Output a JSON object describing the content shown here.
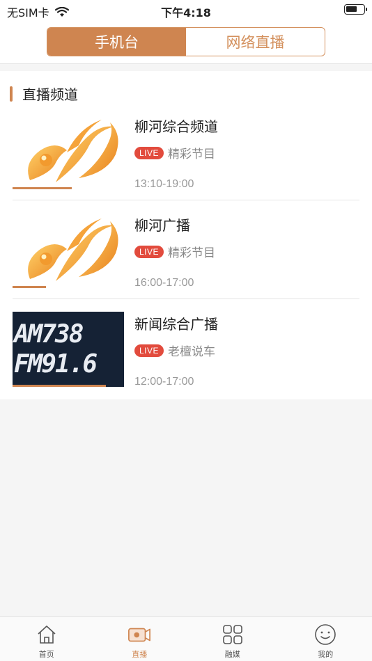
{
  "status_bar": {
    "carrier": "无SIM卡",
    "time": "下午4:18"
  },
  "header": {
    "tabs": [
      {
        "label": "手机台",
        "active": true
      },
      {
        "label": "网络直播",
        "active": false
      }
    ]
  },
  "section": {
    "title": "直播频道"
  },
  "channels": [
    {
      "name": "柳河综合频道",
      "live_label": "LIVE",
      "program": "精彩节目",
      "time": "13:10-19:00",
      "thumb": "swirl-logo",
      "progress": 0.53
    },
    {
      "name": "柳河广播",
      "live_label": "LIVE",
      "program": "精彩节目",
      "time": "16:00-17:00",
      "thumb": "swirl-logo",
      "progress": 0.3
    },
    {
      "name": "新闻综合广播",
      "live_label": "LIVE",
      "program": "老檀说车",
      "time": "12:00-17:00",
      "thumb": "am-fm-sign",
      "thumb_text": [
        "AM738",
        "FM91.6"
      ],
      "progress": 0.84
    }
  ],
  "tabbar": {
    "items": [
      {
        "label": "首页",
        "icon": "home-icon",
        "active": false
      },
      {
        "label": "直播",
        "icon": "live-camera-icon",
        "active": true
      },
      {
        "label": "融媒",
        "icon": "grid-icon",
        "active": false
      },
      {
        "label": "我的",
        "icon": "smile-icon",
        "active": false
      }
    ]
  },
  "colors": {
    "accent": "#cf8550",
    "live_red": "#e24b3d"
  }
}
